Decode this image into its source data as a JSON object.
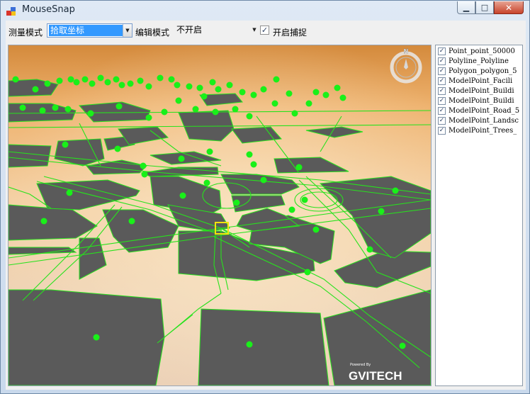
{
  "window": {
    "title": "MouseSnap",
    "minimize_glyph": "▁",
    "maximize_glyph": "□",
    "close_glyph": "✕"
  },
  "toolbar": {
    "measure_label": "测量模式",
    "measure_value": "拾取坐标",
    "edit_label": "编辑模式",
    "edit_value": "不开启",
    "snap_label": "开启捕捉",
    "snap_checked": true,
    "dropdown_glyph": "▼",
    "check_glyph": "✓"
  },
  "layers": {
    "items": [
      {
        "label": "Point_point_50000",
        "checked": true
      },
      {
        "label": "Polyline_Polyline",
        "checked": true
      },
      {
        "label": "Polygon_polygon_5",
        "checked": true
      },
      {
        "label": "ModelPoint_Facili",
        "checked": true
      },
      {
        "label": "ModelPoint_Buildi",
        "checked": true
      },
      {
        "label": "ModelPoint_Buildi",
        "checked": true
      },
      {
        "label": "ModelPoint_Road_5",
        "checked": true
      },
      {
        "label": "ModelPoint_Landsc",
        "checked": true
      },
      {
        "label": "ModelPoint_Trees_",
        "checked": true
      }
    ]
  },
  "viewport": {
    "compass_letter": "N",
    "watermark_powered": "Powered By",
    "watermark_brand": "GVITECH"
  },
  "colors": {
    "block": "#5a5a5a",
    "road_line": "#27e21d",
    "point": "#19f019",
    "snap_box": "#f3e40c"
  }
}
